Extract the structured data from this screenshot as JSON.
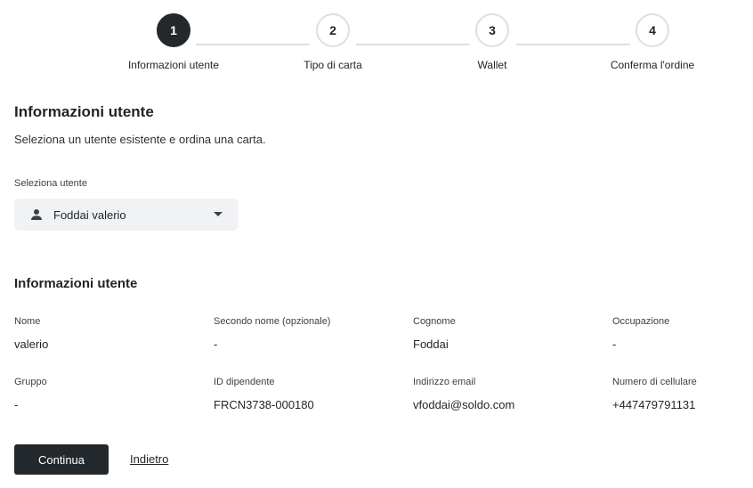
{
  "stepper": {
    "steps": [
      {
        "number": "1",
        "label": "Informazioni utente",
        "active": true
      },
      {
        "number": "2",
        "label": "Tipo di carta",
        "active": false
      },
      {
        "number": "3",
        "label": "Wallet",
        "active": false
      },
      {
        "number": "4",
        "label": "Conferma l'ordine",
        "active": false
      }
    ]
  },
  "header": {
    "title": "Informazioni utente",
    "subtitle": "Seleziona un utente esistente e ordina una carta."
  },
  "user_select": {
    "label": "Seleziona utente",
    "value": "Foddai valerio",
    "icon": "person-icon"
  },
  "info": {
    "title": "Informazioni utente",
    "fields": [
      {
        "label": "Nome",
        "value": "valerio"
      },
      {
        "label": "Secondo nome (opzionale)",
        "value": "-"
      },
      {
        "label": "Cognome",
        "value": "Foddai"
      },
      {
        "label": "Occupazione",
        "value": "-"
      },
      {
        "label": "Gruppo",
        "value": "-"
      },
      {
        "label": "ID dipendente",
        "value": "FRCN3738-000180"
      },
      {
        "label": "Indirizzo email",
        "value": "vfoddai@soldo.com"
      },
      {
        "label": "Numero di cellulare",
        "value": "+447479791131"
      }
    ]
  },
  "actions": {
    "continue_label": "Continua",
    "back_label": "Indietro"
  },
  "colors": {
    "primary": "#23282d",
    "line": "#dcdfe3",
    "select_bg": "#f1f2f4"
  }
}
